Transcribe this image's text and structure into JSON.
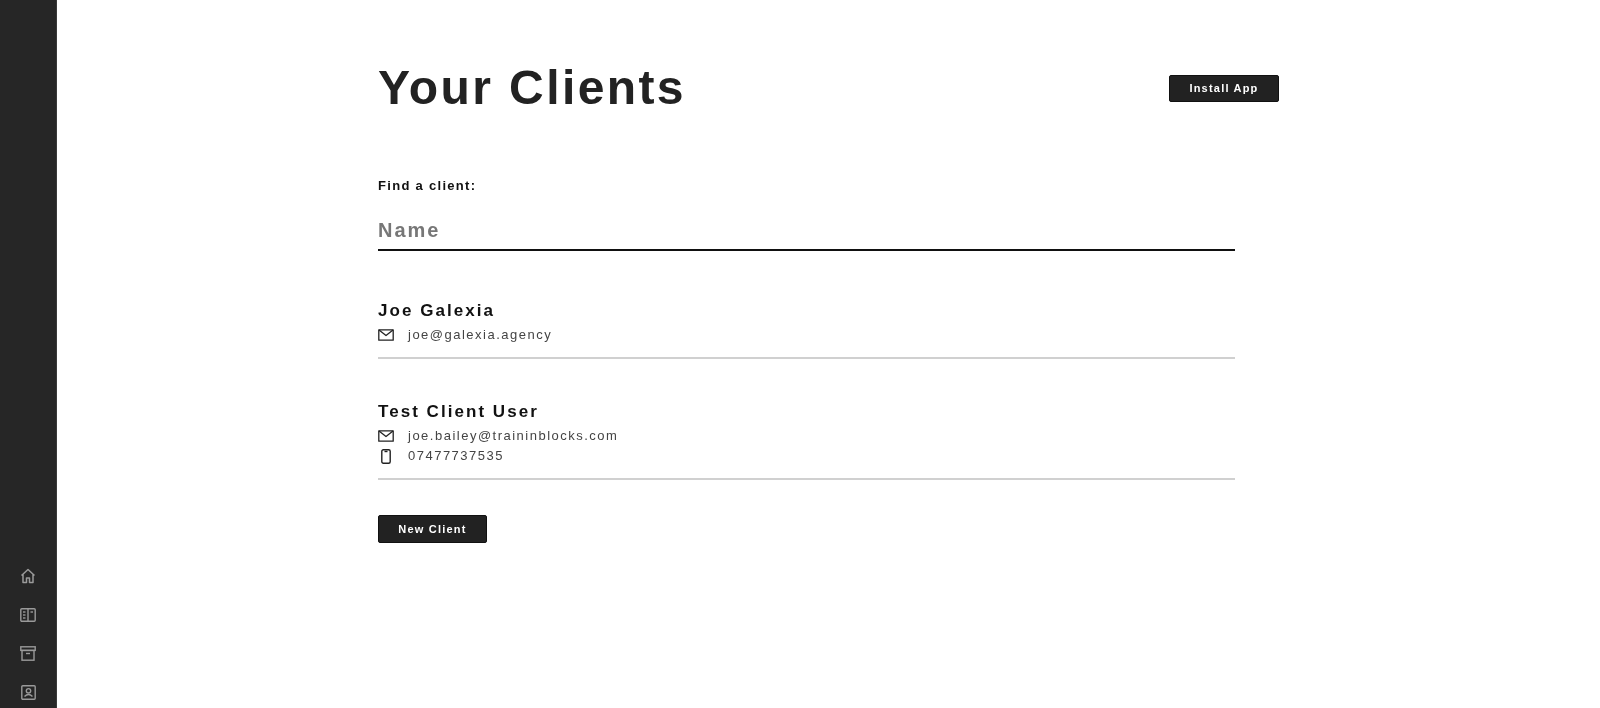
{
  "header": {
    "title": "Your Clients",
    "install_button": "Install App"
  },
  "search": {
    "label": "Find a client:",
    "placeholder": "Name"
  },
  "clients": [
    {
      "name": "Joe Galexia",
      "contacts": [
        {
          "kind": "email",
          "value": "joe@galexia.agency"
        }
      ]
    },
    {
      "name": "Test Client User",
      "contacts": [
        {
          "kind": "email",
          "value": "joe.bailey@traininblocks.com"
        },
        {
          "kind": "phone",
          "value": "07477737535"
        }
      ]
    }
  ],
  "new_client_button": "New Client"
}
